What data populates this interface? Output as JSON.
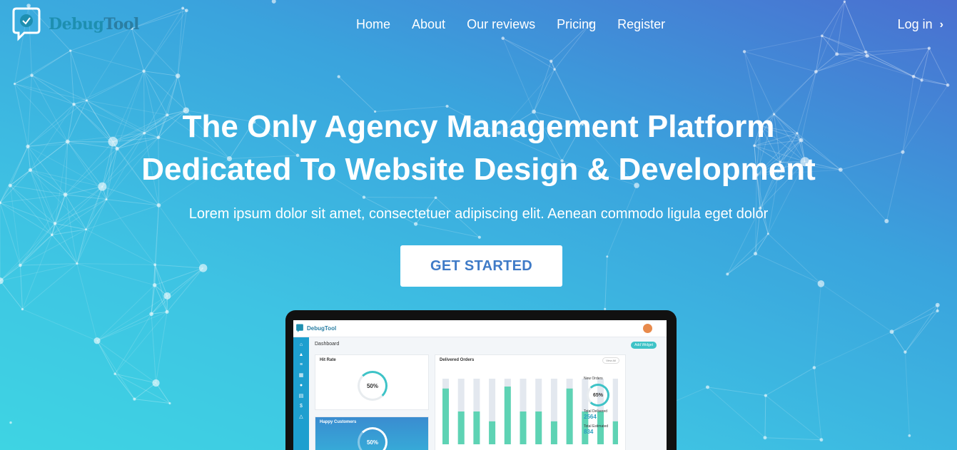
{
  "brand": {
    "name_part1": "Debug",
    "name_part2": "Tool"
  },
  "nav": {
    "items": [
      "Home",
      "About",
      "Our reviews",
      "Pricing",
      "Register"
    ],
    "login_label": "Log in",
    "login_icon": "chevron-right-icon"
  },
  "hero": {
    "title_line1": "The Only Agency Management Platform",
    "title_line2": "Dedicated To Website Design & Development",
    "subtitle": "Lorem ipsum dolor sit amet, consectetuer adipiscing elit. Aenean commodo ligula eget dolor",
    "cta_label": "GET STARTED"
  },
  "colors": {
    "accent": "#3f7bc7",
    "teal": "#3ec3c7",
    "green_bar": "#5ed3b4"
  },
  "dashboard": {
    "brand": "DebugTool",
    "title": "Dashboard",
    "add_widget": "Add Widget",
    "hit_rate": {
      "label": "Hit Rate",
      "value": "50%"
    },
    "happy_customers": {
      "label": "Happy Customers",
      "value": "50%"
    },
    "delivered_orders": {
      "label": "Delivered Orders",
      "view_all": "View All",
      "new_orders_label": "New Orders",
      "new_orders_value": "65%",
      "total_delivered_label": "Total Delivered",
      "total_delivered_value": "2564",
      "total_estimated_label": "Total Estimated",
      "total_estimated_value": "834"
    }
  }
}
